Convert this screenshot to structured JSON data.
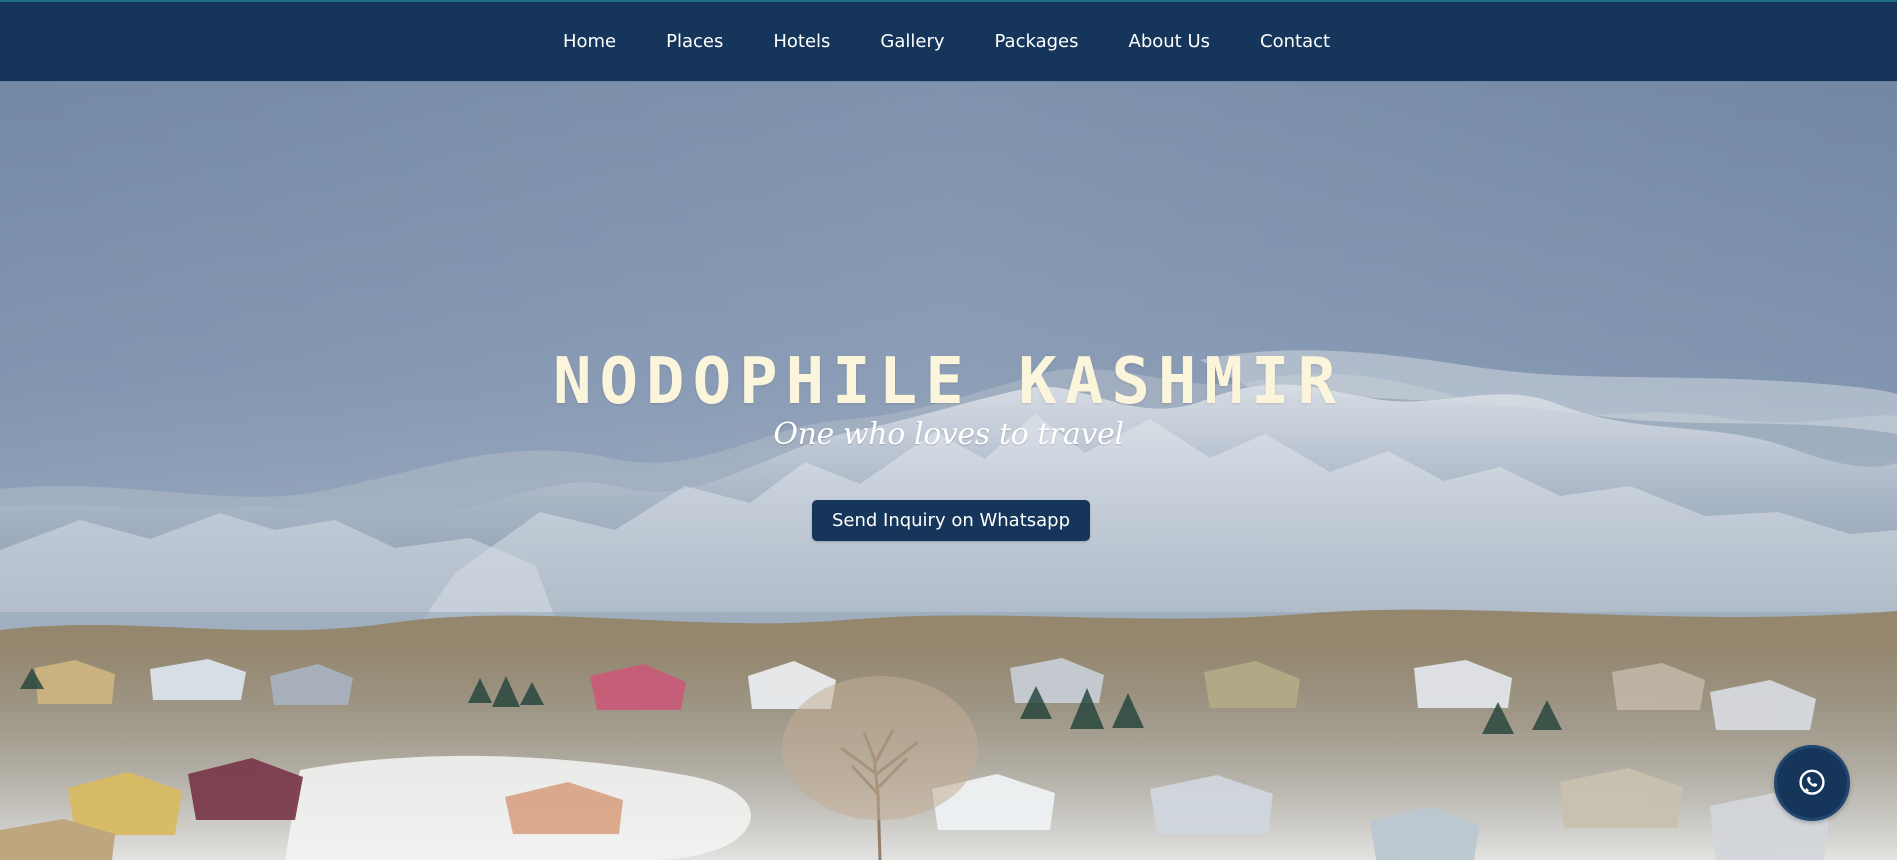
{
  "nav": {
    "items": [
      {
        "label": "Home"
      },
      {
        "label": "Places"
      },
      {
        "label": "Hotels"
      },
      {
        "label": "Gallery"
      },
      {
        "label": "Packages"
      },
      {
        "label": "About Us"
      },
      {
        "label": "Contact"
      }
    ]
  },
  "hero": {
    "title": "NODOPHILE KASHMIR",
    "tagline": "One who loves to travel",
    "cta_label": "Send Inquiry on Whatsapp"
  },
  "floating": {
    "icon": "whatsapp-icon"
  },
  "colors": {
    "nav_background": "#16355a",
    "title_text": "#fbf5dc",
    "button_background": "#16355a"
  }
}
